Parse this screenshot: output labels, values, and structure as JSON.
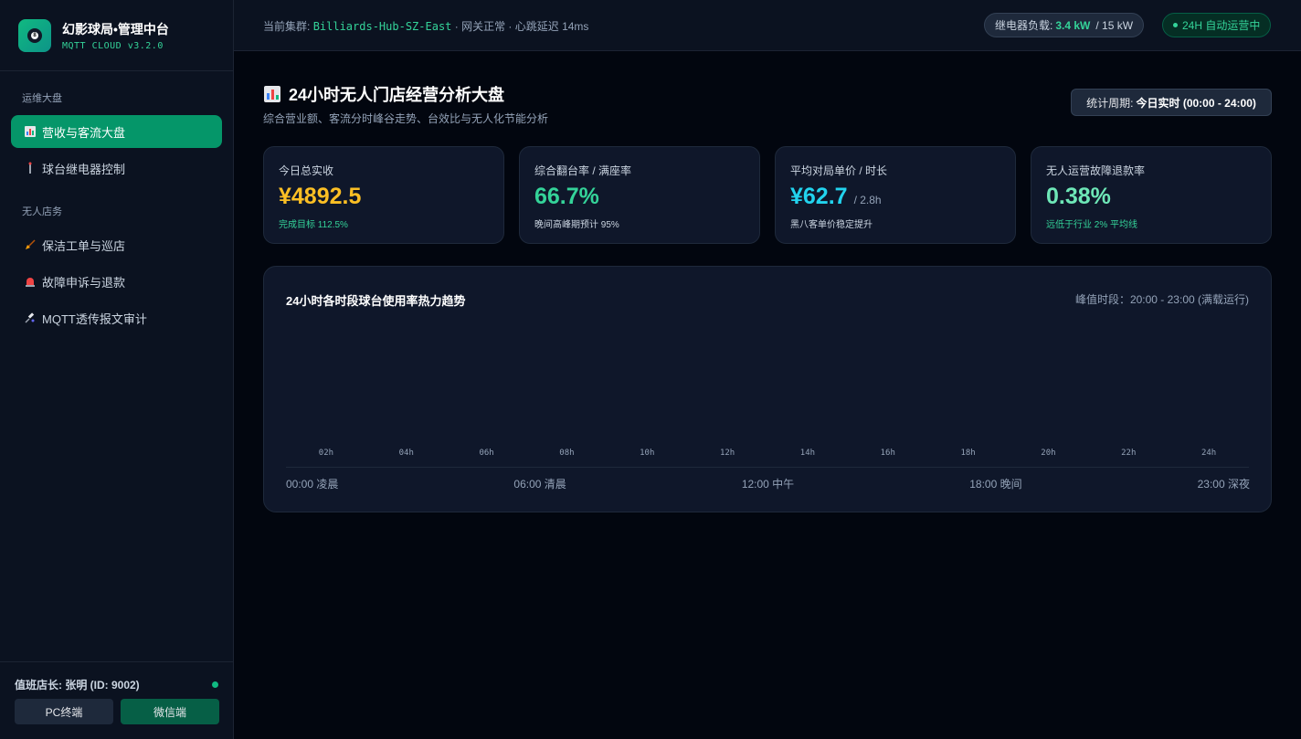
{
  "brand": {
    "title": "幻影球局•管理中台",
    "subtitle": "MQTT CLOUD v3.2.0"
  },
  "sidebar": {
    "sections": [
      {
        "label": "运维大盘"
      },
      {
        "label": "无人店务"
      }
    ],
    "items": [
      {
        "label": "营收与客流大盘",
        "icon": "bar-chart-icon"
      },
      {
        "label": "球台继电器控制",
        "icon": "cue-stick-icon"
      },
      {
        "label": "保洁工单与巡店",
        "icon": "broom-icon"
      },
      {
        "label": "故障申诉与退款",
        "icon": "siren-icon"
      },
      {
        "label": "MQTT透传报文审计",
        "icon": "satellite-icon"
      }
    ],
    "footer": {
      "shift_manager": "值班店长: 张明 (ID: 9002)",
      "pc_label": "PC终端",
      "wechat_label": "微信端"
    }
  },
  "topbar": {
    "cluster_prefix": "当前集群:",
    "cluster_name": "Billiards-Hub-SZ-East",
    "cluster_status": "· 网关正常 · 心跳延迟 14ms",
    "load_label": "继电器负载:",
    "load_value": "3.4 kW",
    "load_capacity": "/ 15 kW",
    "auto_status": "24H 自动运营中"
  },
  "header": {
    "title": "24小时无人门店经营分析大盘",
    "subtitle": "综合营业额、客流分时峰谷走势、台效比与无人化节能分析",
    "period_label": "统计周期:",
    "period_value": "今日实时 (00:00 - 24:00)"
  },
  "kpis": [
    {
      "label": "今日总实收",
      "value": "¥4892.5",
      "unit": "",
      "note": "完成目标 112.5%",
      "value_color": "#fbbf24",
      "note_color": "#34d399"
    },
    {
      "label": "综合翻台率 / 满座率",
      "value": "66.7%",
      "unit": "",
      "note": "晚间高峰期预计 95%",
      "value_color": "#34d399",
      "note_color": "#cbd5e1"
    },
    {
      "label": "平均对局单价 / 时长",
      "value": "¥62.7",
      "unit": "/ 2.8h",
      "note": "黑八客单价稳定提升",
      "value_color": "#22d3ee",
      "note_color": "#cbd5e1"
    },
    {
      "label": "无人运营故障退款率",
      "value": "0.38%",
      "unit": "",
      "note": "远低于行业 2% 平均线",
      "value_color": "#6ee7b7",
      "note_color": "#34d399"
    }
  ],
  "chart_panel": {
    "title": "24小时各时段球台使用率热力趋势",
    "peak": "峰值时段：20:00 - 23:00 (满载运行)",
    "period_labels": [
      "00:00 凌晨",
      "06:00 清晨",
      "12:00 中午",
      "18:00 晚间",
      "23:00 深夜"
    ]
  },
  "chart_data": {
    "type": "bar",
    "categories": [
      "02h",
      "04h",
      "06h",
      "08h",
      "10h",
      "12h",
      "14h",
      "16h",
      "18h",
      "20h",
      "22h",
      "24h"
    ],
    "values": [
      0,
      0,
      0,
      0,
      0,
      0,
      0,
      0,
      0,
      0,
      0,
      0
    ],
    "title": "24小时各时段球台使用率热力趋势",
    "xlabel": "",
    "ylabel": "",
    "grid": false,
    "bar_color": "#10b981"
  }
}
